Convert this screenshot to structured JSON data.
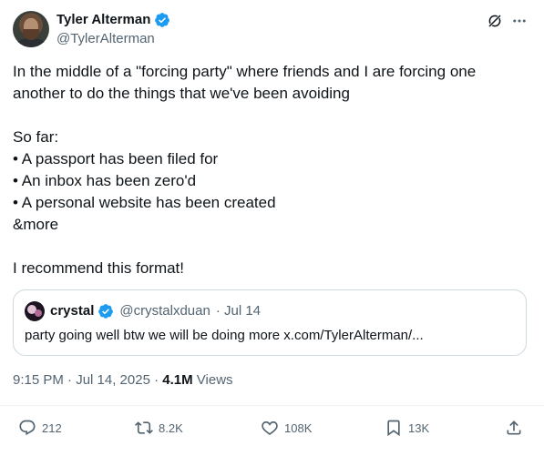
{
  "tweet": {
    "author": {
      "name": "Tyler Alterman",
      "handle": "@TylerAlterman",
      "verified_color": "#1d9bf0"
    },
    "text_lines": [
      "In the middle of a \"forcing party\" where friends and I are forcing one",
      "another to do the things that we've been avoiding",
      "",
      "So far:",
      "• A passport has been filed for",
      "• An inbox has been zero'd",
      "• A personal website has been created",
      "&more",
      "",
      "I recommend this format!"
    ],
    "quote": {
      "name": "crystal",
      "handle": "@crystalxduan",
      "date": "· Jul 14",
      "text": "party going well btw we will be doing more x.com/TylerAlterman/..."
    },
    "timestamp": "9:15 PM · Jul 14, 2025 · ",
    "views_count": "4.1M",
    "views_label": " Views",
    "actions": {
      "replies": "212",
      "reposts": "8.2K",
      "likes": "108K",
      "bookmarks": "13K"
    },
    "icons": {
      "header": [
        "grok-icon",
        "more-icon"
      ],
      "actions": [
        "reply-icon",
        "retweet-icon",
        "like-icon",
        "bookmark-icon",
        "share-icon"
      ]
    },
    "colors": {
      "text": "#0f1419",
      "secondary": "#536471",
      "border": "#cfd9de",
      "accent": "#1d9bf0"
    }
  }
}
